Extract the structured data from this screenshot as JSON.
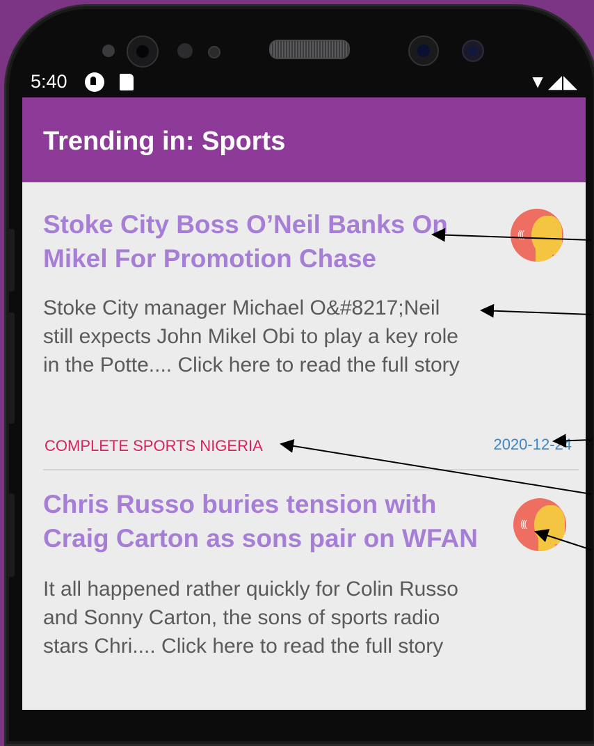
{
  "status_bar": {
    "time": "5:40",
    "icons": [
      "notification-icon",
      "sd-card-icon"
    ],
    "right_icons": [
      "wifi-icon",
      "signal-icon",
      "battery-icon"
    ]
  },
  "app_bar": {
    "title": "Trending in: Sports",
    "color": "#8e3a98"
  },
  "articles": [
    {
      "title": "Stoke City Boss O’Neil Banks On Mikel For Promotion Chase",
      "snippet": "Stoke City manager Michael O&#8217;Neil still expects John Mikel Obi to play a key role in the Potte.... Click here to read the full story",
      "source": "COMPLETE SPORTS NIGERIA",
      "date": "2020-12-24",
      "speak_icon": "text-to-speech-icon"
    },
    {
      "title": "Chris Russo buries tension with Craig Carton as sons pair on WFAN",
      "snippet": "It all happened rather quickly for Colin Russo and Sonny Carton, the sons of sports radio stars Chri.... Click here to read the full story",
      "speak_icon": "text-to-speech-icon"
    }
  ],
  "colors": {
    "headline": "#a77ed6",
    "source": "#d8245a",
    "date": "#3d86c6",
    "background": "#7b3584"
  }
}
